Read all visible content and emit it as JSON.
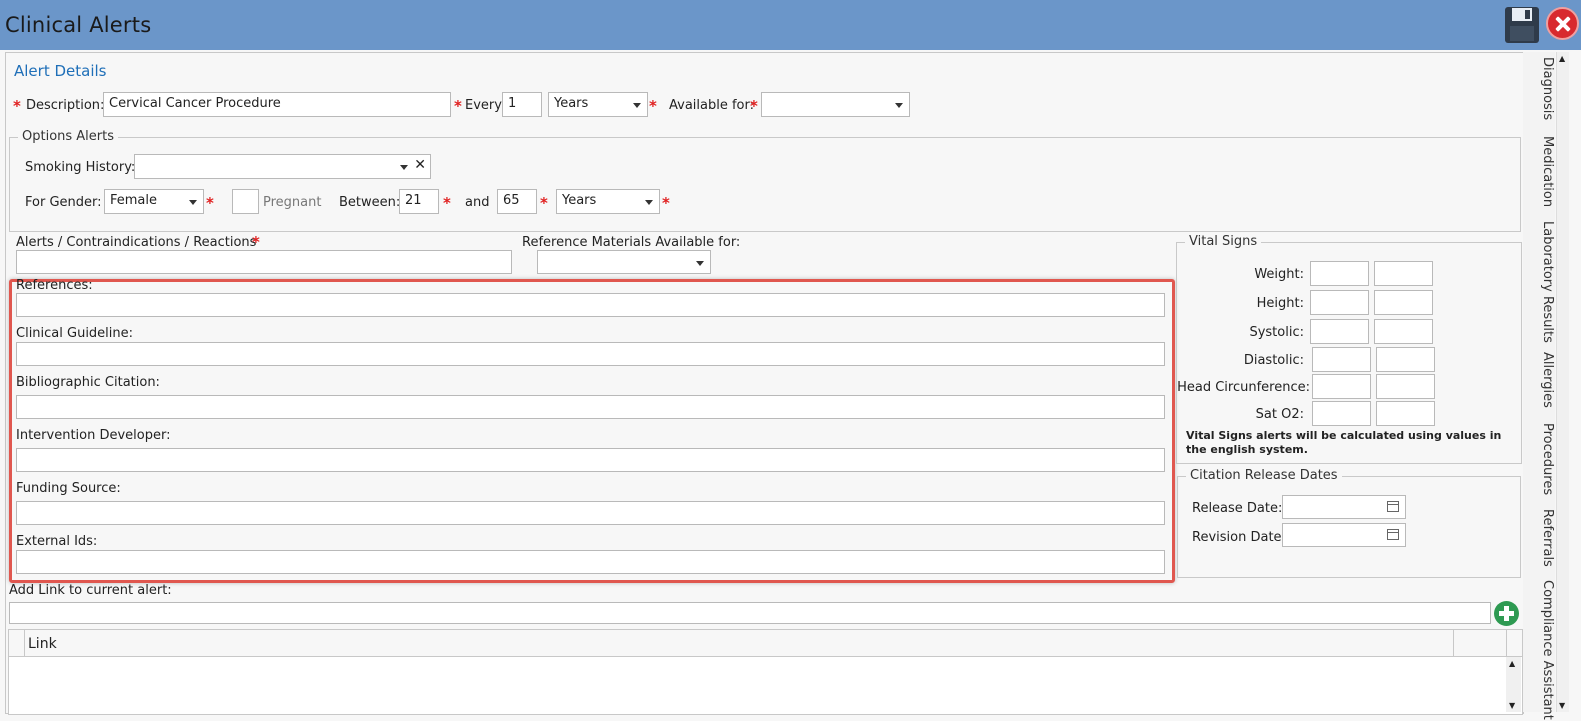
{
  "window": {
    "title": "Clinical Alerts"
  },
  "alert_details": {
    "section_title": "Alert Details",
    "description_label": "Description:",
    "description_value": "Cervical Cancer Procedure",
    "every_label": "Every:",
    "every_value": "1",
    "every_unit": "Years",
    "available_for_label": "Available for:",
    "available_for_value": ""
  },
  "options_alerts": {
    "legend": "Options Alerts",
    "smoking_history_label": "Smoking History:",
    "smoking_history_value": "",
    "for_gender_label": "For Gender:",
    "gender_value": "Female",
    "pregnant_label": "Pregnant",
    "between_label": "Between:",
    "age_from": "21",
    "and_label": "and",
    "age_to": "65",
    "age_unit": "Years"
  },
  "alerts_contra_label": "Alerts / Contraindications / Reactions",
  "reference_materials_label": "Reference Materials Available for:",
  "reference_fields": [
    {
      "label": "References:",
      "value": ""
    },
    {
      "label": "Clinical Guideline:",
      "value": ""
    },
    {
      "label": "Bibliographic Citation:",
      "value": ""
    },
    {
      "label": "Intervention Developer:",
      "value": ""
    },
    {
      "label": "Funding Source:",
      "value": ""
    },
    {
      "label": "External Ids:",
      "value": ""
    }
  ],
  "vital_signs": {
    "legend": "Vital Signs",
    "rows": [
      "Weight:",
      "Height:",
      "Systolic:",
      "Diastolic:",
      "Head Circunference:",
      "Sat O2:"
    ],
    "note": "Vital Signs alerts will be calculated using values in the english system."
  },
  "citation_release": {
    "legend": "Citation Release Dates",
    "release_label": "Release Date:",
    "revision_label": "Revision Date:"
  },
  "add_link_label": "Add Link to current alert:",
  "link_grid": {
    "column": "Link"
  },
  "side_tabs": [
    "Diagnosis",
    "Medication",
    "Laboratory Results",
    "Allergies",
    "Procedures",
    "Referrals",
    "Compliance Assistant"
  ],
  "colors": {
    "titlebar": "#6b96c9",
    "section_title": "#1f6fb8",
    "required": "#e02020",
    "highlight": "#e0574f",
    "add_button": "#2e9a52"
  }
}
